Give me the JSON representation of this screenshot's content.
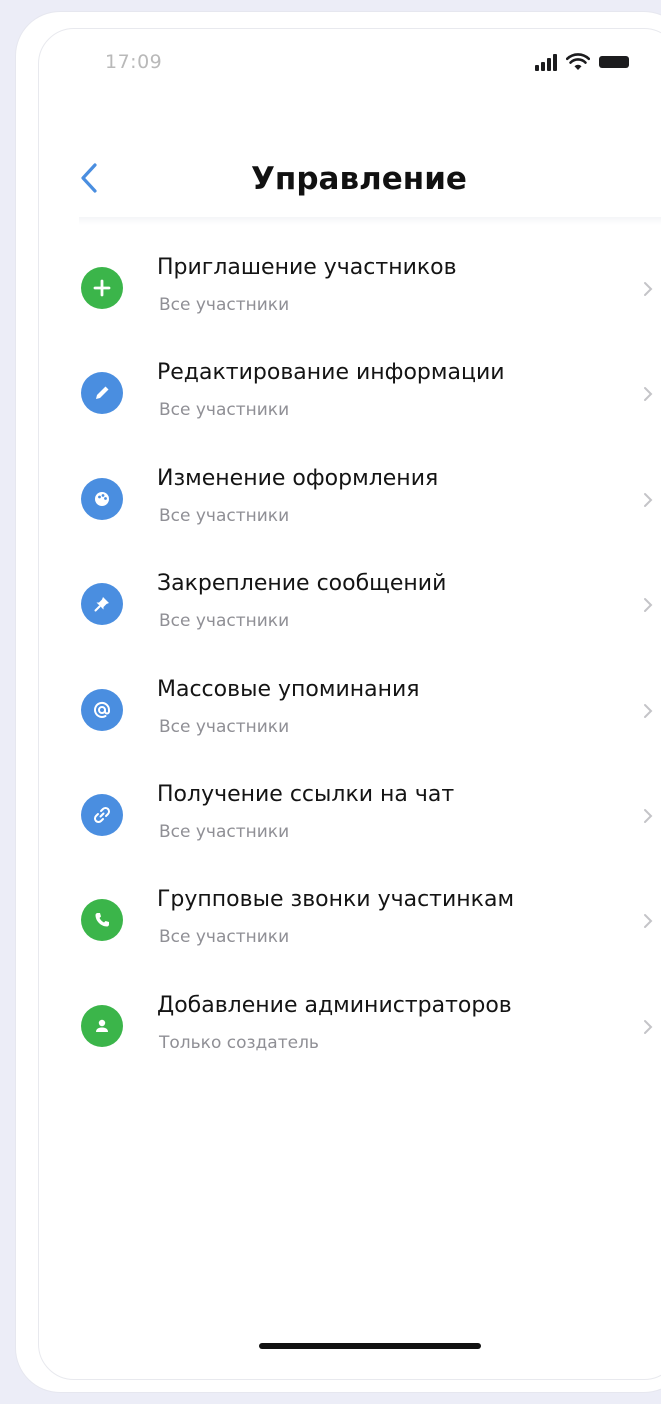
{
  "status_bar": {
    "time": "17:09"
  },
  "header": {
    "title": "Управление"
  },
  "settings": [
    {
      "title": "Приглашение участников",
      "subtitle": "Все участники",
      "icon": "plus-icon",
      "color": "#3bb54a"
    },
    {
      "title": "Редактирование информации",
      "subtitle": "Все участники",
      "icon": "pencil-icon",
      "color": "#4a8ee0"
    },
    {
      "title": "Изменение оформления",
      "subtitle": "Все участники",
      "icon": "palette-icon",
      "color": "#4a8ee0"
    },
    {
      "title": "Закрепление сообщений",
      "subtitle": "Все участники",
      "icon": "pin-icon",
      "color": "#4a8ee0"
    },
    {
      "title": "Массовые упоминания",
      "subtitle": "Все участники",
      "icon": "at-icon",
      "color": "#4a8ee0"
    },
    {
      "title": "Получение ссылки на чат",
      "subtitle": "Все участники",
      "icon": "link-icon",
      "color": "#4a8ee0"
    },
    {
      "title": "Групповые звонки участинкам",
      "subtitle": "Все участники",
      "icon": "phone-icon",
      "color": "#3bb54a"
    },
    {
      "title": "Добавление администраторов",
      "subtitle": "Только создатель",
      "icon": "user-icon",
      "color": "#3bb54a"
    }
  ],
  "colors": {
    "accent_blue": "#4a8ee0",
    "accent_green": "#3bb54a"
  }
}
